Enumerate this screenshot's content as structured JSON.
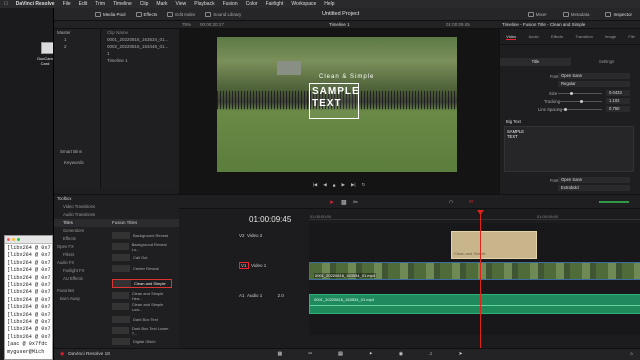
{
  "menubar": {
    "app": "DaVinci Resolve",
    "items": [
      "File",
      "Edit",
      "Trim",
      "Timeline",
      "Clip",
      "Mark",
      "View",
      "Playback",
      "Fusion",
      "Color",
      "Fairlight",
      "Workspace",
      "Help"
    ]
  },
  "desktop": {
    "icon_label_1": "DocCam",
    "icon_label_2": "Card"
  },
  "toolbar": {
    "media_pool": "Media Pool",
    "effects": "Effects",
    "edit_index": "Edit Index",
    "sound_library": "Sound Library",
    "project_title": "Untitled Project",
    "mixer": "Mixer",
    "metadata": "Metadata",
    "inspector": "Inspector"
  },
  "subbar": {
    "zoom": "75%",
    "timecode": "00:00:20:17",
    "timeline_name": "Timeline 1",
    "right_timecode": "01:00:09:45",
    "inspector_title": "Timeline - Fusion Title - Clean and Simple"
  },
  "media_pool": {
    "master": "Master",
    "bins": [
      "1",
      "2"
    ],
    "smart_bins": "Smart Bins",
    "keywords": "Keywords",
    "col_header": "Clip Name",
    "clips": [
      "0001_20220816_163534_01...",
      "0002_20220816_163446_01...",
      "1",
      "Timeline 1"
    ]
  },
  "viewer": {
    "title_line1": "Clean & Simple",
    "title_line2": "SAMPLE",
    "title_line3": "TEXT"
  },
  "inspector": {
    "tabs": [
      "Video",
      "Audio",
      "Effects",
      "Transition",
      "Image",
      "File"
    ],
    "subtabs": [
      "Title",
      "Settings"
    ],
    "font_label": "Font",
    "font_value": "Open Sans",
    "style_value": "Regular",
    "size_label": "Size",
    "size_value": "0.0433",
    "tracking_label": "Tracking",
    "tracking_value": "1.102",
    "line_spacing_label": "Line Spacing",
    "line_spacing_value": "0.750",
    "big_text_section": "Big Text",
    "big_text_value": "SAMPLE\nTEXT",
    "font2_value": "Open Sans",
    "style2_value": "Extrabold"
  },
  "effects": {
    "toolbox": "Toolbox",
    "categories": [
      "Video Transitions",
      "Audio Transitions",
      "Titles",
      "Generators",
      "Effects",
      "Open FX",
      "Filters",
      "Audio FX",
      "Fairlight FX",
      "AU Effects",
      "Favorites",
      "Burn Away"
    ],
    "panel_title": "Fusion Titles",
    "items": [
      "Background Reveal",
      "Background Reveal Lo...",
      "Call Out",
      "Center Reveal",
      "Clean and Simple",
      "Clean and Simple Hea...",
      "Clean and Simple Low...",
      "Dark Box Text",
      "Dark Box Text Lower T...",
      "Digital Glitch"
    ]
  },
  "timeline": {
    "timecode": "01:00:09:45",
    "ruler_start": "01:00:00:00",
    "ruler_mid": "01:00:08:00",
    "tracks": {
      "v2": {
        "id": "V2",
        "name": "Video 2"
      },
      "v1": {
        "id": "V1",
        "name": "Video 1"
      },
      "a1": {
        "id": "A1",
        "name": "Audio 1",
        "level": "2.0"
      }
    },
    "title_clip": "Clean and Simple",
    "video_clip": "0001_20220816_163534_01.mp4",
    "audio_clip": "0001_20220816_163534_01.mp4"
  },
  "status": {
    "app_name": "DaVinci Resolve 18",
    "pages": [
      "Media",
      "Cut",
      "Edit",
      "Fusion",
      "Color",
      "Fairlight",
      "Deliver"
    ]
  },
  "terminal": {
    "lines": [
      "[libx264 @ 0x7",
      "[libx264 @ 0x7",
      "[libx264 @ 0x7",
      "[libx264 @ 0x7",
      "[libx264 @ 0x7",
      "[libx264 @ 0x7",
      "[libx264 @ 0x7",
      "[libx264 @ 0x7",
      "[libx264 @ 0x7",
      "[libx264 @ 0x7",
      "[libx264 @ 0x7",
      "[libx264 @ 0x7",
      "[libx264 @ 0x7",
      "[aac @ 0x7fdc",
      "myguser@Mich"
    ]
  }
}
